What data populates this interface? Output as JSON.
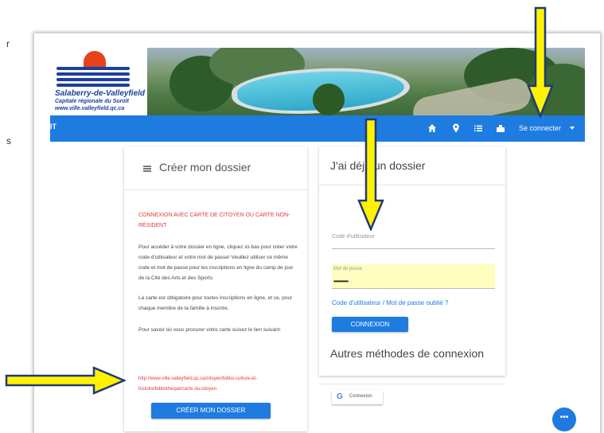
{
  "edge_fragments": [
    "r",
    "s"
  ],
  "logo": {
    "name": "Salaberry-de-Valleyfield",
    "tagline": "Capitale régionale du Suroît",
    "url": "www.ville.valleyfield.qc.ca"
  },
  "navbar": {
    "left_text": "IT",
    "icons": [
      "home-icon",
      "location-pin-icon",
      "list-icon",
      "building-icon"
    ],
    "login_label": "Se connecter"
  },
  "create_card": {
    "title": "Créer mon dossier",
    "red_heading": "CONNEXION AVEC CARTE DE CITOYEN OU CARTE NON-RÉSIDENT",
    "paragraph_1": "Pour accéder à votre dossier en ligne, cliquez ici-bas pour créer votre code d'utilisateur et votre mot de passe! Veuillez utiliser ce même code et mot de passe pour les inscriptions en ligne du camp de jour de la Cité des Arts et des Sports.",
    "paragraph_2": "La carte est obligatoire pour toutes inscriptions en ligne, et ce, pour chaque membre de la famille à inscrire.",
    "paragraph_3": "Pour savoir où vous procurer votre carte suivez le lien suivant:",
    "link": "http://www.ville.valleyfield.qc.ca/citoyen/biblio-culture-et-histoire/bibliotheque/carte-du-citoyen",
    "button_label": "CRÉER MON DOSSIER"
  },
  "login_card": {
    "title": "J'ai déjà un dossier",
    "username_label": "Code d'utilisateur",
    "password_label": "Mot de passe",
    "password_value": "••••••••••",
    "forgot_link": "Code d'utilisateur / Mot de passe oublié ?",
    "connect_button": "CONNEXION",
    "other_methods_title": "Autres méthodes de connexion",
    "google_letter": "G",
    "google_label": "Connexion"
  },
  "fab": {
    "label": "•••"
  },
  "colors": {
    "accent": "#1e7be0",
    "red_text": "#e53935",
    "autofill": "#fefcbf",
    "annotation_arrow": "#fff200",
    "annotation_outline": "#1f3a7a"
  }
}
